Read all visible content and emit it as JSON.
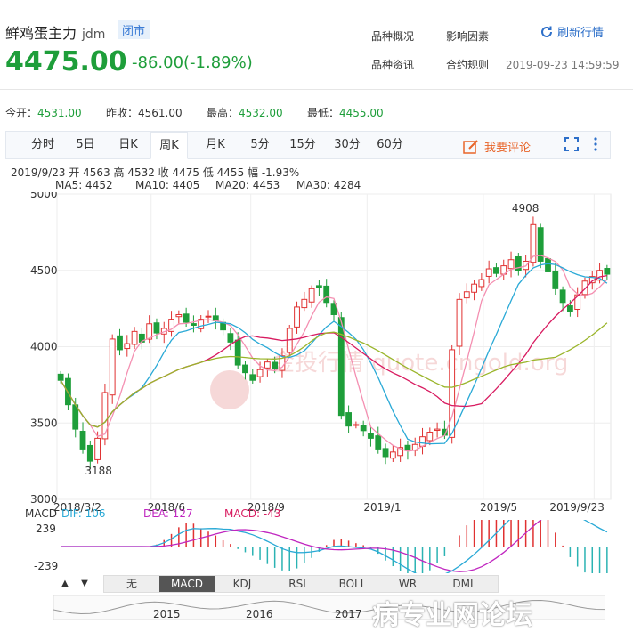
{
  "header": {
    "name": "鲜鸡蛋主力",
    "code": "jdm",
    "status": "闭市",
    "price": "4475.00",
    "change": "-86.00(-1.89%)",
    "links": [
      "品种概况",
      "影响因素",
      "品种资讯",
      "合约规则"
    ],
    "refresh": "刷新行情",
    "timestamp": "2019-09-23 14:59:59"
  },
  "stats": [
    {
      "label": "今开：",
      "value": "4531.00"
    },
    {
      "label": "昨收：",
      "value": "4561.00"
    },
    {
      "label": "最高：",
      "value": "4532.00"
    },
    {
      "label": "最低：",
      "value": "4455.00"
    }
  ],
  "tabs": [
    "分时",
    "5日",
    "日K",
    "周K",
    "月K",
    "5分",
    "15分",
    "30分",
    "60分"
  ],
  "active_tab": "周K",
  "comment": "我要评论",
  "ohlc_line": "2019/9/23  开 4563  高 4532  收 4475  低 4455  幅 -1.93%",
  "ma": [
    {
      "label": "MA5: 4452",
      "color": "#f48fb1"
    },
    {
      "label": "MA10: 4405",
      "color": "#29a9d6"
    },
    {
      "label": "MA20: 4453",
      "color": "#d81b60"
    },
    {
      "label": "MA30: 4284",
      "color": "#9ab52a"
    }
  ],
  "macd": {
    "name": "MACD",
    "dif": "DIF: 106",
    "dea": "DEA: 127",
    "macd": "MACD: -43",
    "dif_color": "#29a9d6",
    "dea_color": "#c026c0",
    "macd_color": "#d81b60",
    "yticks": [
      "239",
      "-239"
    ]
  },
  "bottom_tabs": [
    "无",
    "MACD",
    "KDJ",
    "RSI",
    "BOLL",
    "WR",
    "DMI"
  ],
  "bottom_active": "MACD",
  "nav_years": [
    "2015",
    "2016",
    "2017"
  ],
  "watermark": "金投行情 quote.cngold.org",
  "overlay": "病专业网论坛",
  "chart_data": {
    "type": "candlestick",
    "ylabels": [
      "5000",
      "4500",
      "4000",
      "3500",
      "3000"
    ],
    "xlabels": [
      "2018/3/2",
      "2018/6",
      "2018/9",
      "2019/1",
      "2019/5",
      "2019/9/23"
    ],
    "high_annotation": "4908",
    "low_annotation": "3188",
    "ylim": [
      3000,
      5000
    ],
    "up_color": "#e03131",
    "down_color": "#1e9e3a",
    "close_trend": [
      3780,
      3620,
      3460,
      3330,
      3250,
      3400,
      3700,
      4050,
      3980,
      4020,
      4100,
      4030,
      4150,
      4090,
      4120,
      4180,
      4210,
      4160,
      4140,
      4180,
      4200,
      4170,
      4110,
      4030,
      3880,
      3830,
      3780,
      3850,
      3900,
      3860,
      3940,
      4120,
      4260,
      4310,
      4380,
      4390,
      4290,
      4210,
      3550,
      3480,
      3490,
      3450,
      3400,
      3330,
      3280,
      3310,
      3340,
      3320,
      3360,
      3410,
      3440,
      3460,
      3420,
      3980,
      4310,
      4360,
      4410,
      4440,
      4510,
      4480,
      4530,
      4570,
      4500,
      4560,
      4800,
      4560,
      4490,
      4380,
      4290,
      4230,
      4340,
      4430,
      4460,
      4500,
      4475
    ]
  }
}
